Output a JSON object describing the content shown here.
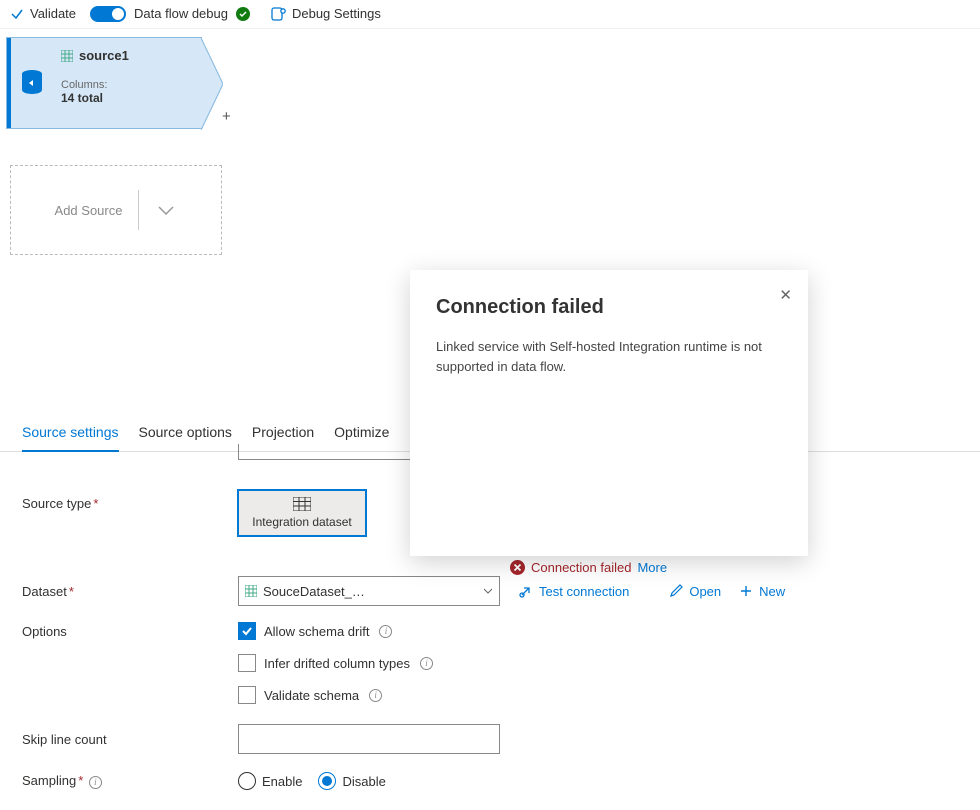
{
  "toolbar": {
    "validate": "Validate",
    "debug_label": "Data flow debug",
    "debug_settings": "Debug Settings"
  },
  "node": {
    "title": "source1",
    "columns_label": "Columns:",
    "columns_total": "14 total"
  },
  "add_source": "Add Source",
  "tabs": {
    "source_settings": "Source settings",
    "source_options": "Source options",
    "projection": "Projection",
    "optimize": "Optimize"
  },
  "form": {
    "source_type": "Source type",
    "integration_dataset": "Integration dataset",
    "dataset": "Dataset",
    "dataset_value": "SouceDataset_…",
    "test_connection": "Test connection",
    "open": "Open",
    "new": "New",
    "options": "Options",
    "allow_drift": "Allow schema drift",
    "infer_drift": "Infer drifted column types",
    "validate_schema": "Validate schema",
    "skip_line": "Skip line count",
    "sampling": "Sampling",
    "enable": "Enable",
    "disable": "Disable"
  },
  "error": {
    "title": "Connection failed",
    "message": "Linked service with Self-hosted Integration runtime is not supported in data flow.",
    "inline": "Connection failed",
    "more": "More"
  }
}
